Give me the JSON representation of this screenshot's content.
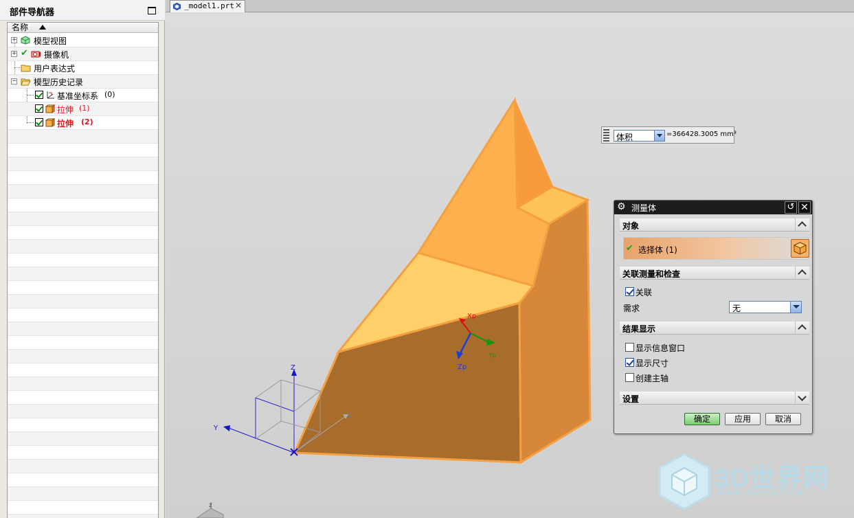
{
  "navigator": {
    "title": "部件导航器",
    "column_header": "名称",
    "items": [
      {
        "label": "模型视图",
        "icon": "model-views-icon"
      },
      {
        "label": "摄像机",
        "icon": "camera-icon"
      },
      {
        "label": "用户表达式",
        "icon": "folder-icon"
      },
      {
        "label": "模型历史记录",
        "icon": "folder-open-icon"
      },
      {
        "label": "基准坐标系",
        "suffix": "(0)",
        "icon": "datum-csys-icon"
      },
      {
        "label": "拉伸",
        "suffix": "(1)",
        "icon": "extrude-icon"
      },
      {
        "label": "拉伸",
        "suffix": "(2)",
        "icon": "extrude-icon"
      }
    ]
  },
  "tab": {
    "title": "_model1.prt",
    "close_glyph": "✕"
  },
  "readout": {
    "type": "体积",
    "value": "=366428.3005 mm³"
  },
  "dialog": {
    "title": "测量体",
    "groups": {
      "object": "对象",
      "assoc": "关联测量和检查",
      "results": "结果显示",
      "settings": "设置"
    },
    "select_body": "选择体 (1)",
    "associative_label": "关联",
    "requirement_label": "需求",
    "requirement_value": "无",
    "checkboxes": [
      {
        "label": "显示信息窗口",
        "checked": false
      },
      {
        "label": "显示尺寸",
        "checked": true
      },
      {
        "label": "创建主轴",
        "checked": false
      }
    ],
    "associative_checked": true,
    "buttons": {
      "ok": "确定",
      "apply": "应用",
      "cancel": "取消"
    }
  },
  "axes": {
    "z": "Z",
    "y": "Y",
    "x": "X",
    "xp": "Xp",
    "zp": "Zp",
    "yp": "Yp"
  },
  "watermark": {
    "big": "3D世界网",
    "small": "WWW.3DSJW.COM"
  },
  "colors": {
    "body_light": "#ffd06a",
    "body_mid": "#ffb04e",
    "body_dark": "#a86c2c",
    "body_edge": "#f5a040",
    "dialog_title": "#1d1d1d"
  }
}
